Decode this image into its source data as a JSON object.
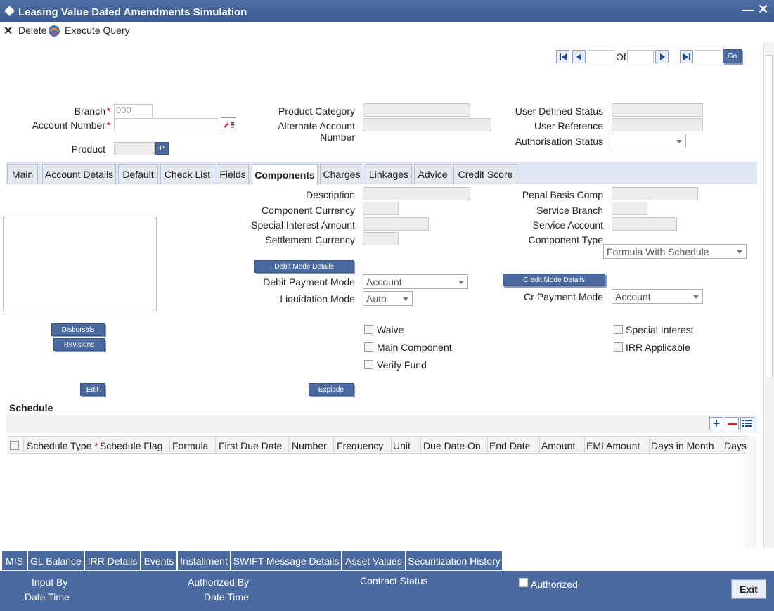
{
  "window": {
    "title": "Leasing Value Dated Amendments Simulation"
  },
  "toolbar": {
    "delete_label": "Delete",
    "execute_query_label": "Execute Query"
  },
  "pager": {
    "of_label": "Of",
    "go_label": "Go"
  },
  "header": {
    "branch_label": "Branch",
    "branch_value": "000",
    "account_number_label": "Account Number",
    "product_label": "Product",
    "product_button": "P",
    "product_category_label": "Product Category",
    "alternate_account_label_1": "Alternate Account",
    "alternate_account_label_2": "Number",
    "user_defined_status_label": "User Defined Status",
    "user_reference_label": "User Reference",
    "authorisation_status_label": "Authorisation Status"
  },
  "tabs": [
    "Main",
    "Account Details",
    "Default",
    "Check List",
    "Fields",
    "Components",
    "Charges",
    "Linkages",
    "Advice",
    "Credit Score"
  ],
  "components": {
    "description_label": "Description",
    "component_currency_label": "Component Currency",
    "special_interest_amount_label": "Special Interest Amount",
    "settlement_currency_label": "Settlement Currency",
    "penal_basis_comp_label": "Penal Basis Comp",
    "service_branch_label": "Service Branch",
    "service_account_label": "Service Account",
    "component_type_label": "Component Type",
    "component_type_value": "Formula With Schedule",
    "debit_mode_details_button": "Debit Mode Details",
    "credit_mode_details_button": "Credit Mode Details",
    "debit_payment_mode_label": "Debit Payment Mode",
    "debit_payment_mode_value": "Account",
    "liquidation_mode_label": "Liquidation Mode",
    "liquidation_mode_value": "Auto",
    "cr_payment_mode_label": "Cr Payment Mode",
    "cr_payment_mode_value": "Account",
    "disbursals_button": "Disbursals",
    "revisions_button": "Revisions",
    "edit_button": "Edit",
    "explode_button": "Explode",
    "waive_label": "Waive",
    "main_component_label": "Main Component",
    "verify_fund_label": "Verify Fund",
    "special_interest_label": "Special Interest",
    "irr_applicable_label": "IRR Applicable"
  },
  "schedule": {
    "title": "Schedule",
    "columns": [
      "Schedule Type",
      "Schedule Flag",
      "Formula",
      "First Due Date",
      "Number",
      "Frequency",
      "Unit",
      "Due Date On",
      "End Date",
      "Amount",
      "EMI Amount",
      "Days in Month",
      "Days"
    ]
  },
  "bottom_tabs": [
    "MIS",
    "GL Balance",
    "IRR Details",
    "Events",
    "Installment",
    "SWIFT Message Details",
    "Asset Values",
    "Securitization History"
  ],
  "footer": {
    "input_by_label": "Input By",
    "date_time_label": "Date Time",
    "authorized_by_label": "Authorized By",
    "date_time_label_2": "Date Time",
    "contract_status_label": "Contract Status",
    "authorized_label": "Authorized",
    "exit_button": "Exit"
  }
}
